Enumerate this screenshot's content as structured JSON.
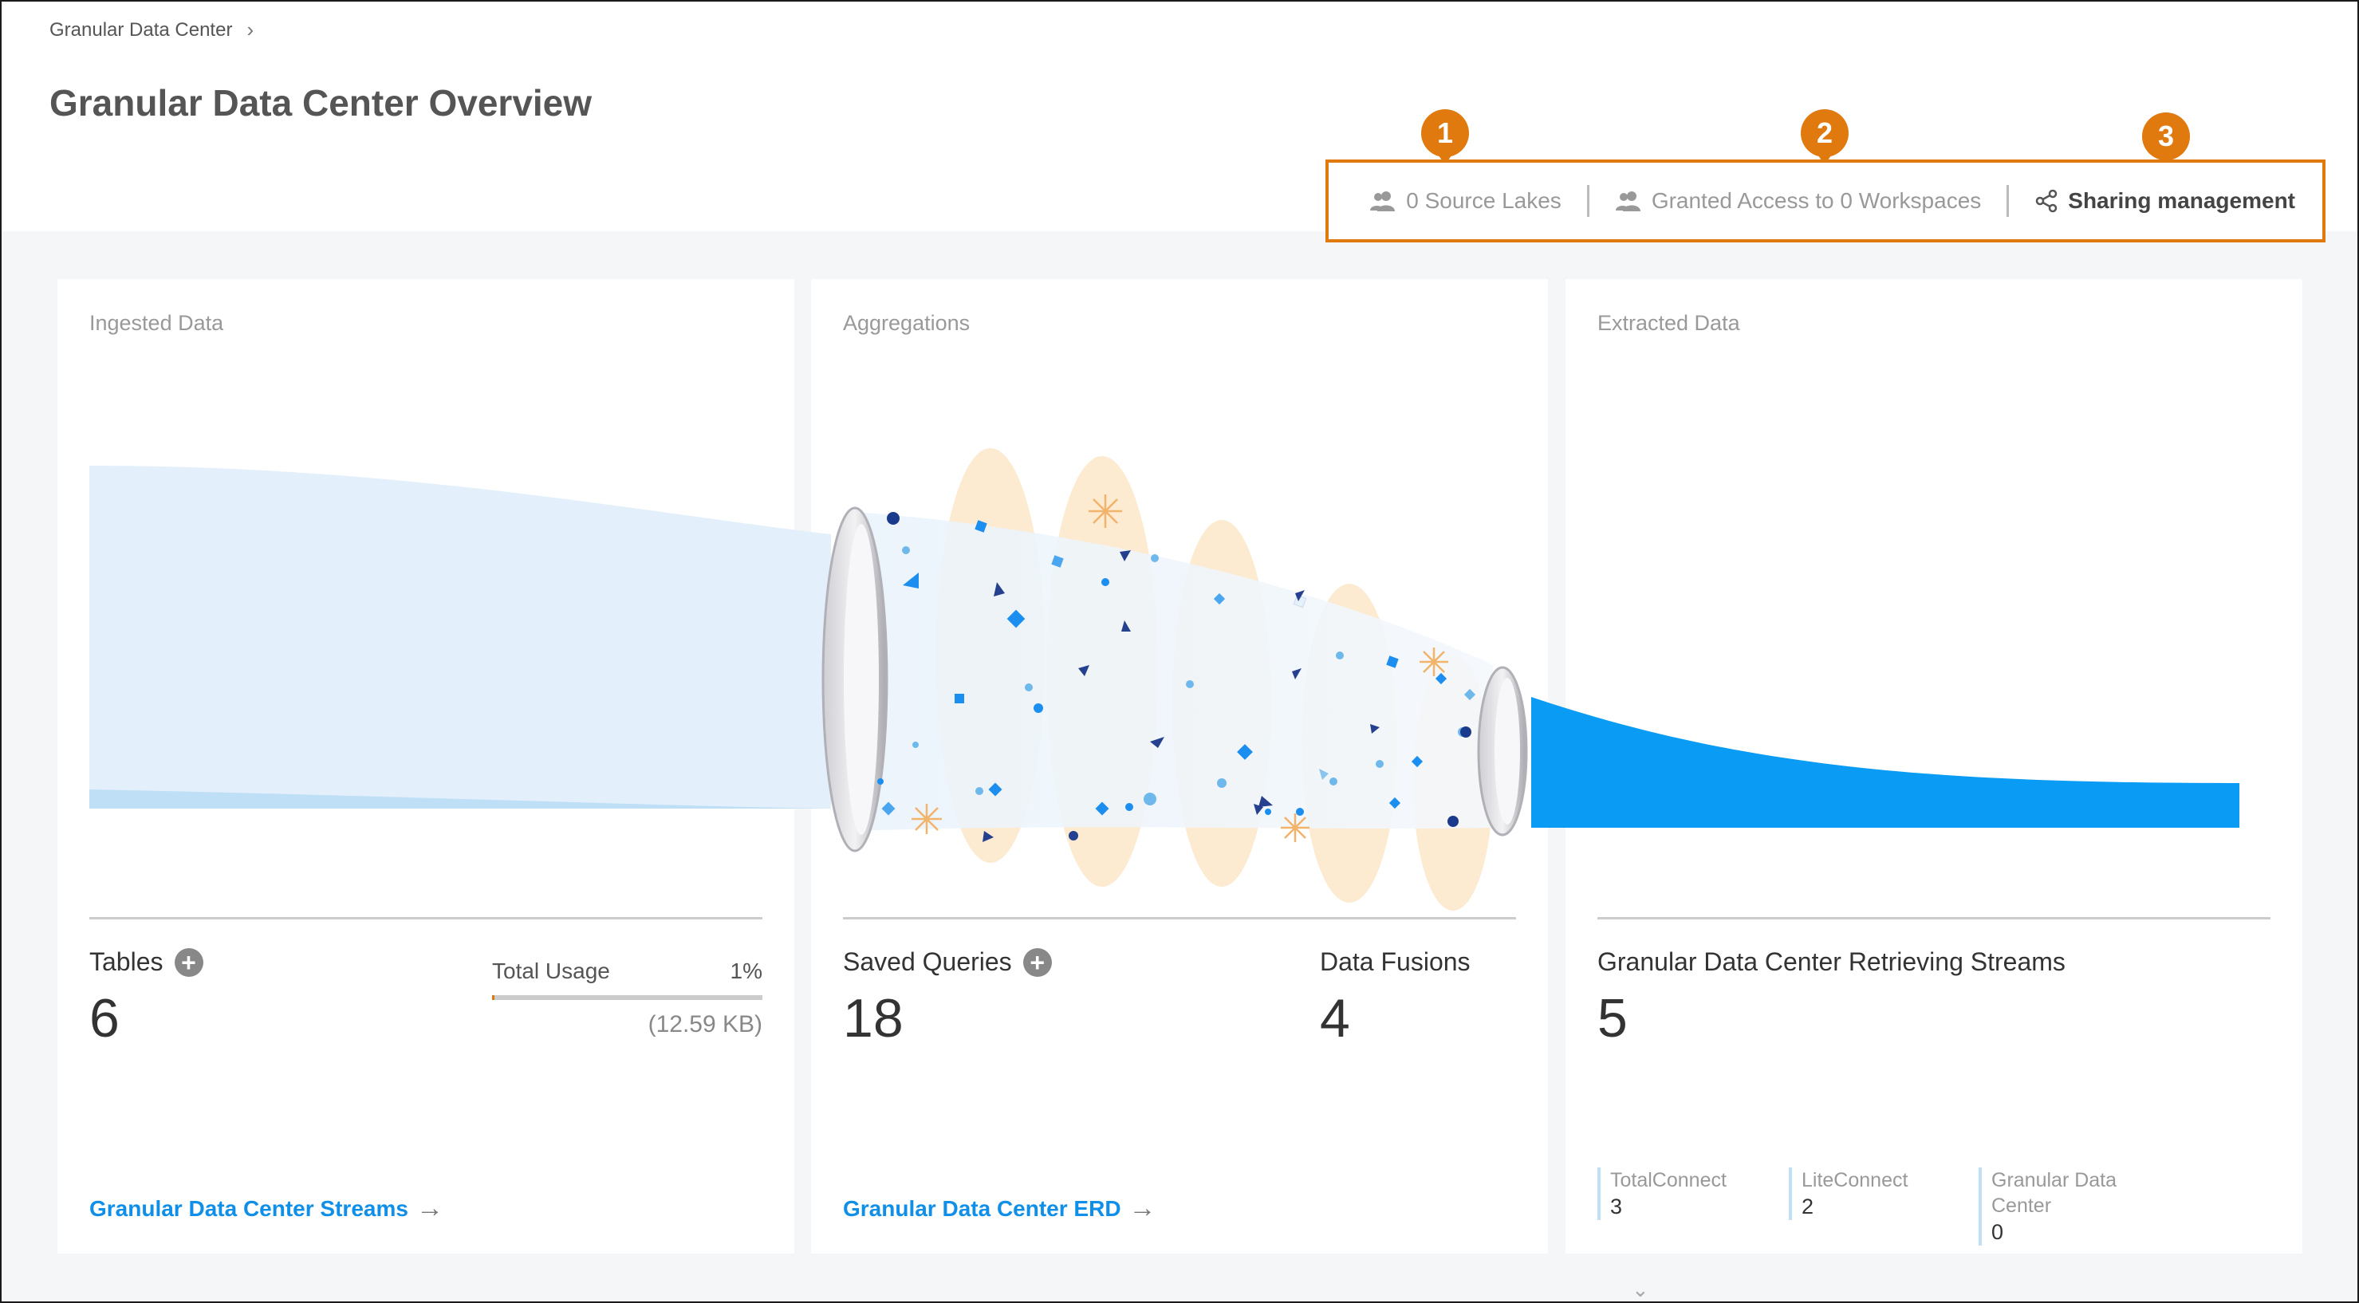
{
  "breadcrumb": {
    "label": "Granular Data Center"
  },
  "page": {
    "title": "Granular Data Center Overview"
  },
  "callouts": [
    "1",
    "2",
    "3"
  ],
  "action_bar": {
    "source_lakes": "0 Source Lakes",
    "granted_access": "Granted Access to 0 Workspaces",
    "sharing": "Sharing management"
  },
  "ingested": {
    "title": "Ingested Data",
    "tables_label": "Tables",
    "tables_value": "6",
    "usage_label": "Total Usage",
    "usage_pct": "1%",
    "usage_fraction": 0.01,
    "usage_size": "(12.59 KB)",
    "link": "Granular Data Center Streams"
  },
  "aggregations": {
    "title": "Aggregations",
    "queries_label": "Saved Queries",
    "queries_value": "18",
    "fusions_label": "Data Fusions",
    "fusions_value": "4",
    "link": "Granular Data Center ERD"
  },
  "extracted": {
    "title": "Extracted Data",
    "streams_label": "Granular Data Center Retrieving Streams",
    "streams_value": "5",
    "sub": [
      {
        "label": "TotalConnect",
        "value": "3"
      },
      {
        "label": "LiteConnect",
        "value": "2"
      },
      {
        "label": "Granular Data Center",
        "value": "0"
      }
    ]
  },
  "colors": {
    "accent": "#0f8fe8",
    "callout": "#e07a0e",
    "flow_light": "#e3f0fb",
    "flow_dark": "#0a9cf5"
  },
  "icons": [
    "people-icon",
    "share-icon",
    "plus-icon",
    "arrow-right-icon",
    "chevron-right-icon",
    "chevron-down-icon"
  ]
}
